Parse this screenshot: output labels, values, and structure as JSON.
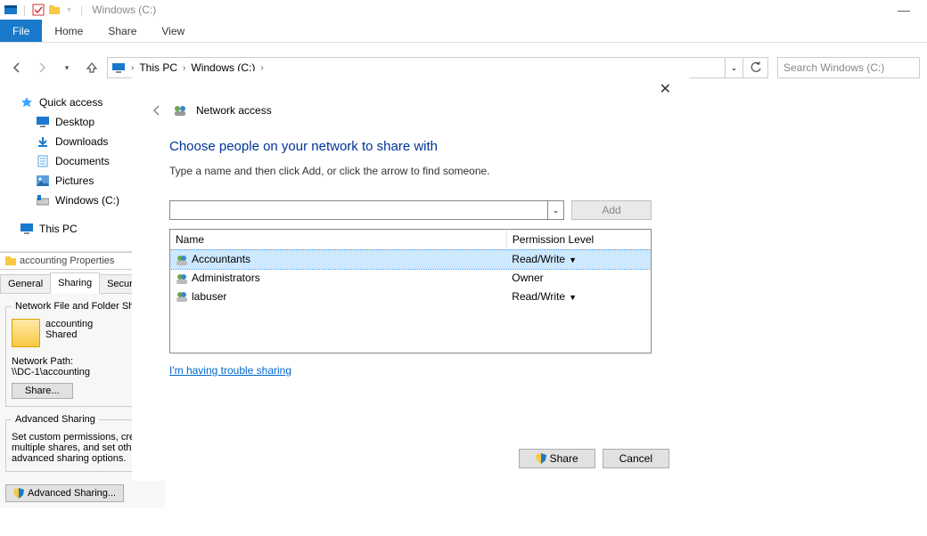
{
  "window": {
    "title": "Windows (C:)",
    "min": "—"
  },
  "ribbon": {
    "file": "File",
    "home": "Home",
    "share": "Share",
    "view": "View"
  },
  "breadcrumb": {
    "this_pc": "This PC",
    "drive": "Windows (C:)"
  },
  "search": {
    "placeholder": "Search Windows (C:)"
  },
  "sidebar": {
    "quick_access": "Quick access",
    "desktop": "Desktop",
    "downloads": "Downloads",
    "documents": "Documents",
    "pictures": "Pictures",
    "drive": "Windows (C:)",
    "this_pc": "This PC"
  },
  "props": {
    "title": "accounting Properties",
    "tab_general": "General",
    "tab_sharing": "Sharing",
    "tab_security": "Security",
    "group1": "Network File and Folder Sh",
    "folder_name": "accounting",
    "folder_state": "Shared",
    "network_path_label": "Network Path:",
    "network_path": "\\\\DC-1\\accounting",
    "share_btn": "Share...",
    "group2": "Advanced Sharing",
    "adv_desc": "Set custom permissions, create multiple shares, and set other advanced sharing options.",
    "adv_btn": "Advanced Sharing..."
  },
  "dialog": {
    "title": "Network access",
    "heading": "Choose people on your network to share with",
    "sub": "Type a name and then click Add, or click the arrow to find someone.",
    "add_btn": "Add",
    "col_name": "Name",
    "col_perm": "Permission Level",
    "rows": [
      {
        "name": "Accountants",
        "perm": "Read/Write",
        "dd": true,
        "selected": true
      },
      {
        "name": "Administrators",
        "perm": "Owner",
        "dd": false,
        "selected": false
      },
      {
        "name": "labuser",
        "perm": "Read/Write",
        "dd": true,
        "selected": false
      }
    ],
    "trouble": "I'm having trouble sharing",
    "share_btn": "Share",
    "cancel_btn": "Cancel"
  }
}
